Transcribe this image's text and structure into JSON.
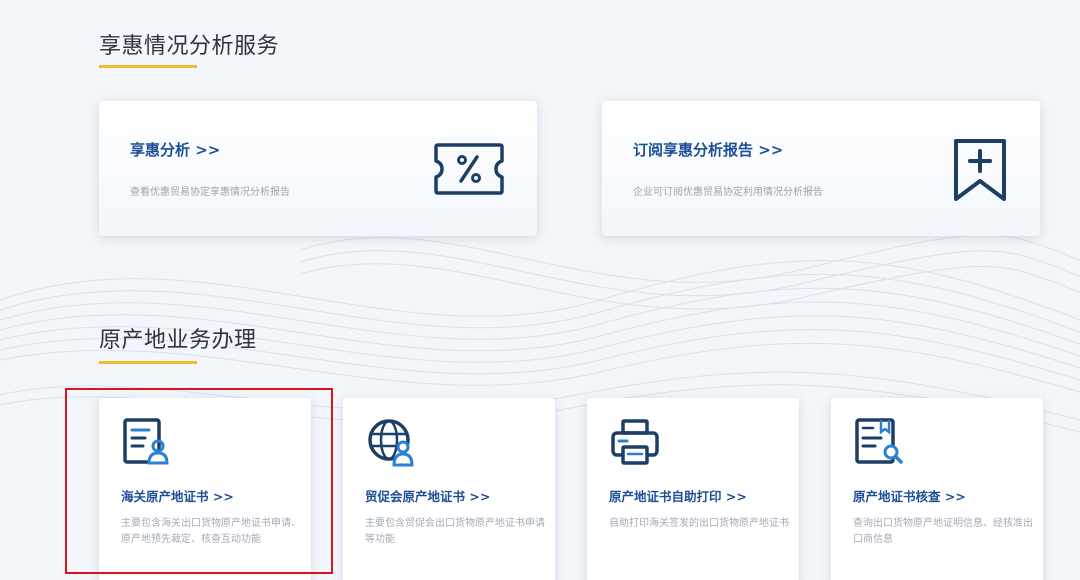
{
  "section1": {
    "title": "享惠情况分析服务",
    "cards": [
      {
        "label": "享惠分析 >>",
        "desc": "查看优惠贸易协定享惠情况分析报告",
        "icon": "percent-ticket-icon"
      },
      {
        "label": "订阅享惠分析报告 >>",
        "desc": "企业可订阅优惠贸易协定利用情况分析报告",
        "icon": "bookmark-plus-icon"
      }
    ]
  },
  "section2": {
    "title": "原产地业务办理",
    "cards": [
      {
        "label": "海关原产地证书 >>",
        "desc": "主要包含海关出口货物原产地证书申请、原产地预先裁定、核查互动功能",
        "icon": "certificate-person-icon"
      },
      {
        "label": "贸促会原产地证书 >>",
        "desc": "主要包含贸促会出口货物原产地证书申请等功能",
        "icon": "globe-person-icon"
      },
      {
        "label": "原产地证书自助打印 >>",
        "desc": "自助打印海关签发的出口货物原产地证书",
        "icon": "printer-icon"
      },
      {
        "label": "原产地证书核查 >>",
        "desc": "查询出口货物原产地证明信息、经核准出口商信息",
        "icon": "certificate-search-icon"
      }
    ]
  },
  "colors": {
    "accent_underline": "#f1b92e",
    "link_blue": "#1d4e96",
    "highlight_red": "#d9141c"
  }
}
